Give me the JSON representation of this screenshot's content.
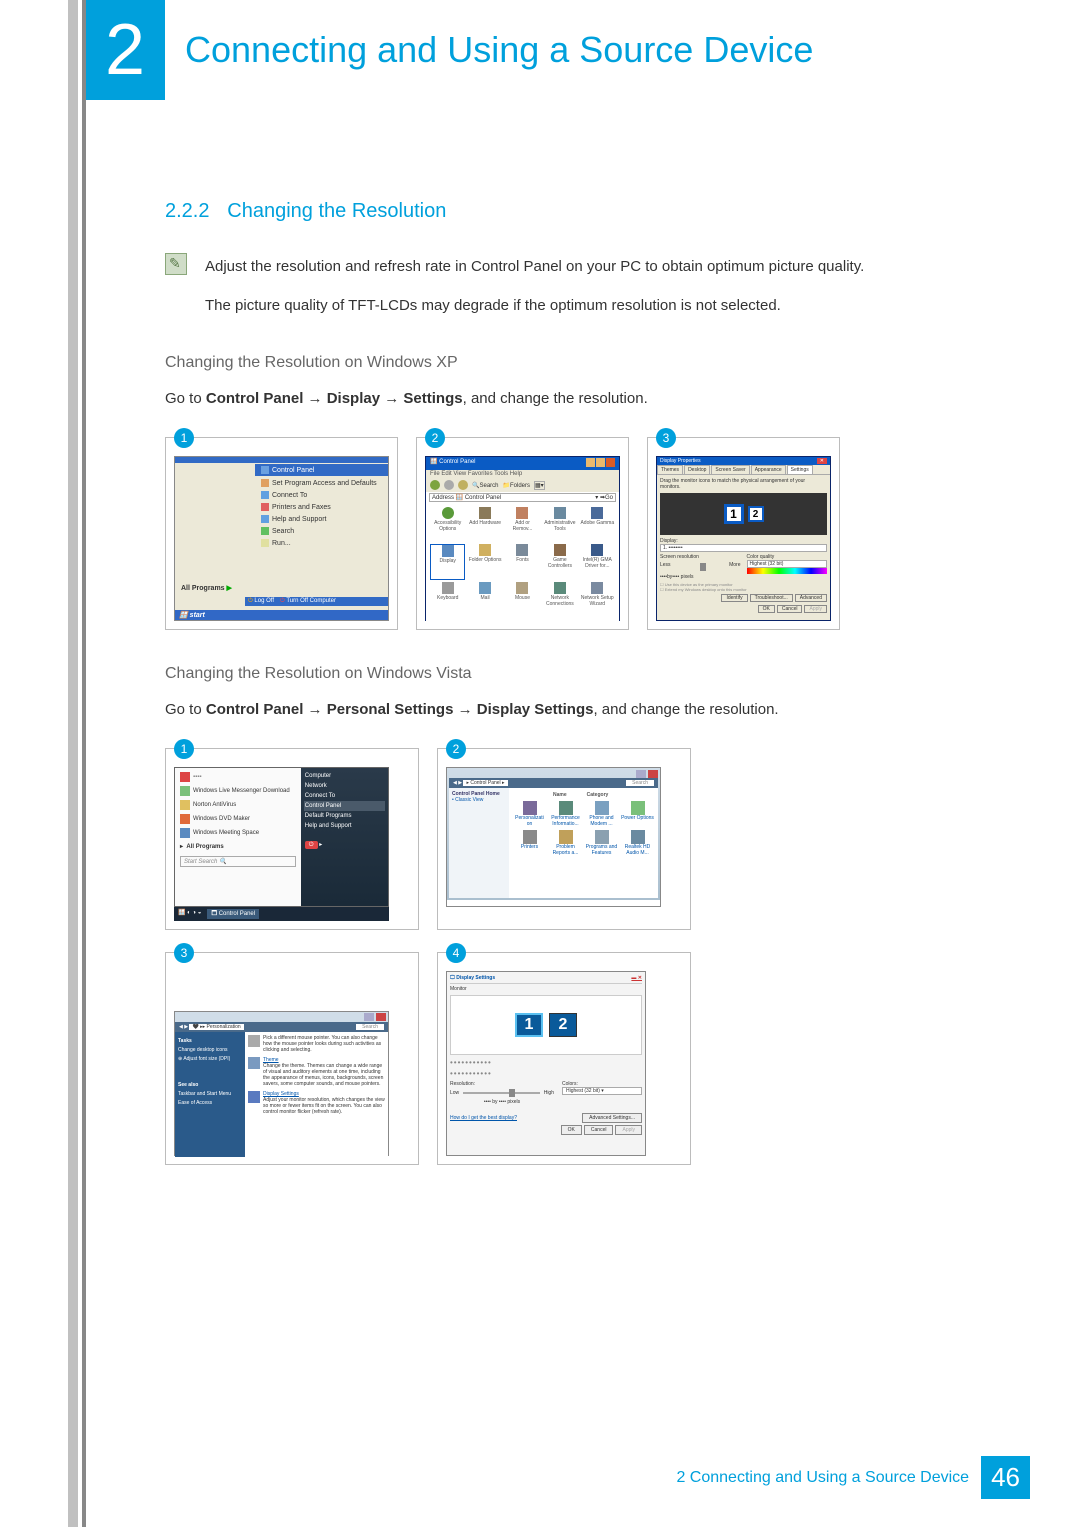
{
  "header": {
    "chapter_number": "2",
    "chapter_title": "Connecting and Using a Source Device"
  },
  "section": {
    "number": "2.2.2",
    "title": "Changing the Resolution"
  },
  "note": {
    "line1": "Adjust the resolution and refresh rate in Control Panel on your PC to obtain optimum picture quality.",
    "line2": "The picture quality of TFT-LCDs may degrade if the optimum resolution is not selected."
  },
  "xp": {
    "subsection": "Changing the Resolution on Windows XP",
    "instruction_prefix": "Go to ",
    "path1": "Control Panel",
    "arrow": " → ",
    "path2": "Display",
    "path3": "Settings",
    "instruction_suffix": ", and change the resolution.",
    "badges": [
      "1",
      "2",
      "3"
    ],
    "start": {
      "highlight": "Control Panel",
      "items": [
        "Set Program Access and Defaults",
        "Connect To",
        "Printers and Faxes",
        "Help and Support",
        "Search",
        "Run..."
      ],
      "all_programs": "All Programs",
      "logoff": "Log Off",
      "turnoff": "Turn Off Computer",
      "start": "start"
    },
    "cp": {
      "title": "Control Panel",
      "menu": "File   Edit   View   Favorites   Tools   Help",
      "search": "Search",
      "folders": "Folders",
      "address": "Control Panel",
      "icons": [
        "Accessibility Options",
        "Add Hardware",
        "Add or Remov...",
        "Administrative Tools",
        "Adobe Gamma",
        "Display",
        "Folder Options",
        "Fonts",
        "Game Controllers",
        "Intel(R) GMA Driver for...",
        "Keyboard",
        "Mail",
        "Mouse",
        "Network Connections",
        "Network Setup Wizard"
      ]
    },
    "disp": {
      "title": "Display Properties",
      "tabs": [
        "Themes",
        "Desktop",
        "Screen Saver",
        "Appearance",
        "Settings"
      ],
      "hint": "Drag the monitor icons to match the physical arrangement of your monitors.",
      "mon1": "1",
      "mon2": "2",
      "display_label": "Display:",
      "display_value": "1. ••••••••",
      "res_label": "Screen resolution",
      "less": "Less",
      "more": "More",
      "resvalue": "••••by•••• pixels",
      "color_label": "Color quality",
      "color_value": "Highest (32 bit)",
      "morecb": "",
      "btns": [
        "Identify",
        "Troubleshoot...",
        "Advanced"
      ],
      "okrow": [
        "OK",
        "Cancel",
        "Apply"
      ]
    }
  },
  "vista": {
    "subsection": "Changing the Resolution on Windows Vista",
    "instruction_prefix": "Go to ",
    "path1": "Control Panel",
    "path2": "Personal Settings",
    "path3": "Display Settings",
    "instruction_suffix": ", and change the resolution.",
    "badges": [
      "1",
      "2",
      "3",
      "4"
    ],
    "start": {
      "items": [
        "Windows Live Messenger Download",
        "Norton AntiVirus",
        "Windows DVD Maker",
        "Windows Meeting Space"
      ],
      "all_programs": "All Programs",
      "search": "Start Search",
      "right": [
        "Computer",
        "Network",
        "Connect To",
        "Control Panel",
        "Default Programs",
        "Help and Support"
      ]
    },
    "cp": {
      "title": "Control Panel",
      "breadcrumb": "▸ Control Panel ▸",
      "search": "Search",
      "side_title": "Control Panel Home",
      "side_link": "Classic View",
      "hdr_name": "Name",
      "hdr_cat": "Category",
      "icons": [
        "Personalizati on",
        "Performance Informatio...",
        "Phone and Modem ...",
        "Power Options",
        "Printers",
        "Problem Reports a...",
        "Programs and Features",
        "Realtek HD Audio M..."
      ]
    },
    "pers": {
      "breadcrumb": "▸▸ Personalization",
      "search": "Search",
      "side": [
        "Tasks",
        "Change desktop icons",
        "Adjust font size (DPI)",
        "See also",
        "Taskbar and Start Menu",
        "Ease of Access"
      ],
      "main1_title": "Pick a different mouse pointer. You can also change how the mouse pointer looks during such activities as clicking and selecting.",
      "theme": "Theme",
      "theme_desc": "Change the theme. Themes can change a wide range of visual and auditory elements at one time, including the appearance of menus, icons, backgrounds, screen savers, some computer sounds, and mouse pointers.",
      "disp_link": "Display Settings",
      "disp_desc": "Adjust your monitor resolution, which changes the view so more or fewer items fit on the screen. You can also control monitor flicker (refresh rate)."
    },
    "disp": {
      "title": "Display Settings",
      "monitor_label": "Monitor",
      "mon1": "1",
      "mon2": "2",
      "dots": "•••••••••••",
      "res_label": "Resolution:",
      "low": "Low",
      "high": "High",
      "resvalue": "•••• by •••• pixels",
      "colors_label": "Colors:",
      "colors_value": "Highest (32 bit)",
      "help_link": "How do I get the best display?",
      "adv": "Advanced Settings...",
      "okrow": [
        "OK",
        "Cancel",
        "Apply"
      ]
    }
  },
  "footer": {
    "text": "2 Connecting and Using a Source Device",
    "page": "46"
  }
}
